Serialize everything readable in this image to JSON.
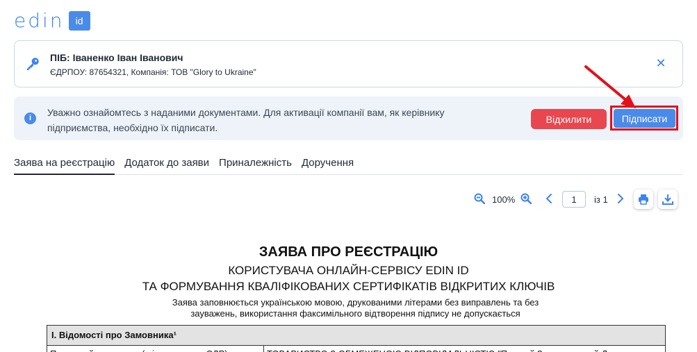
{
  "logo": {
    "text": "edin",
    "badge": "id"
  },
  "user": {
    "name": "ПІБ: Іваненко Іван Іванович",
    "details": "ЄДРПОУ: 87654321, Компанія: ТОВ \"Glory to Ukraine\""
  },
  "notice": {
    "text": "Уважно ознайомтесь з наданими документами. Для активації компанії вам, як керівнику підприємства, необхідно їх підписати.",
    "reject_label": "Відхилити",
    "sign_label": "Підписати"
  },
  "tabs": [
    {
      "label": "Заява на реєстрацію"
    },
    {
      "label": "Додаток до заяви"
    },
    {
      "label": "Приналежність"
    },
    {
      "label": "Доручення"
    }
  ],
  "toolbar": {
    "zoom": "100%",
    "page_value": "1",
    "page_of": "із 1"
  },
  "document": {
    "title": "ЗАЯВА ПРО РЕЄСТРАЦІЮ",
    "subtitle1": "КОРИСТУВАЧА ОНЛАЙН-СЕРВІСУ EDIN ID",
    "subtitle2": "ТА ФОРМУВАННЯ КВАЛІФІКОВАНИХ СЕРТИФІКАТІВ ВІДКРИТИХ КЛЮЧІВ",
    "note": "Заява заповнюється українською мовою, друкованими літерами без виправлень та без зауважень, використання факсимільного відтворення підпису не допускається",
    "section": "І. Відомості про Замовника¹",
    "row_label": "Повне найменування (згідно даних з ЄДР)",
    "row_value": "ТОВАРИСТВО З ОБМЕЖЕНОЮ ВІДПОВІДАЛЬНІСТЮ \"Перший Закарпатський Дата"
  },
  "colors": {
    "accent": "#4a8be9",
    "reject": "#e8474f",
    "highlight": "#e3101b",
    "notice_bg": "#eef3fa"
  }
}
